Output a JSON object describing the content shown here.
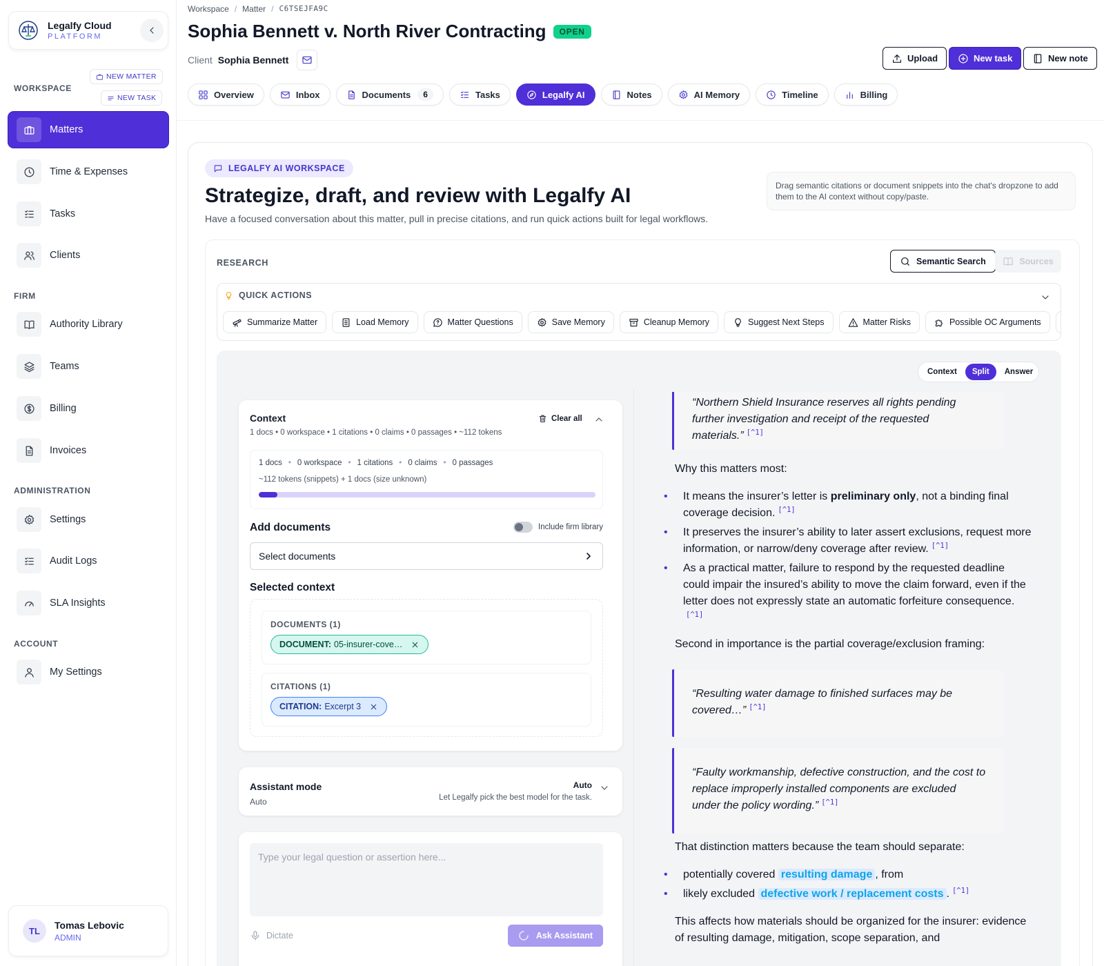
{
  "brand": {
    "name": "Legalfy Cloud",
    "sub": "PLATFORM"
  },
  "sidebar": {
    "sections": {
      "workspace": "WORKSPACE",
      "firm": "FIRM",
      "admin": "ADMINISTRATION",
      "account": "ACCOUNT"
    },
    "new_matter": "NEW MATTER",
    "new_task": "NEW TASK",
    "items": [
      {
        "label": "Matters",
        "icon": "briefcase-icon"
      },
      {
        "label": "Time & Expenses",
        "icon": "clock-icon"
      },
      {
        "label": "Tasks",
        "icon": "list-check-icon"
      },
      {
        "label": "Clients",
        "icon": "users-icon"
      },
      {
        "label": "Authority Library",
        "icon": "book-icon"
      },
      {
        "label": "Teams",
        "icon": "layers-icon"
      },
      {
        "label": "Billing",
        "icon": "dollar-icon"
      },
      {
        "label": "Invoices",
        "icon": "file-icon"
      },
      {
        "label": "Settings",
        "icon": "gear-icon"
      },
      {
        "label": "Audit Logs",
        "icon": "list-check-icon"
      },
      {
        "label": "SLA Insights",
        "icon": "gauge-icon"
      },
      {
        "label": "My Settings",
        "icon": "user-icon"
      }
    ],
    "user": {
      "initials": "TL",
      "name": "Tomas Lebovic",
      "role": "ADMIN"
    }
  },
  "header": {
    "breadcrumb": [
      "Workspace",
      "Matter",
      "C6TSEJFA9C"
    ],
    "title": "Sophia Bennett v. North River Contracting",
    "status": "OPEN",
    "client_label": "Client",
    "client_name": "Sophia Bennett",
    "buttons": {
      "upload": "Upload",
      "new_task": "New task",
      "new_note": "New note"
    },
    "tabs": [
      {
        "label": "Overview"
      },
      {
        "label": "Inbox"
      },
      {
        "label": "Documents",
        "count": "6"
      },
      {
        "label": "Tasks"
      },
      {
        "label": "Legalfy AI"
      },
      {
        "label": "Notes"
      },
      {
        "label": "AI Memory"
      },
      {
        "label": "Timeline"
      },
      {
        "label": "Billing"
      }
    ]
  },
  "workspace": {
    "pill": "LEGALFY AI WORKSPACE",
    "title": "Strategize, draft, and review with Legalfy AI",
    "subtitle": "Have a focused conversation about this matter, pull in precise citations, and run quick actions built for legal workflows.",
    "tip": "Drag semantic citations or document snippets into the chat's dropzone to add them to the AI context without copy/paste."
  },
  "research": {
    "label": "RESEARCH",
    "semantic_search": "Semantic Search",
    "sources": "Sources",
    "quick_actions_label": "QUICK ACTIONS",
    "quick_actions": [
      "Summarize Matter",
      "Load Memory",
      "Matter Questions",
      "Save Memory",
      "Cleanup Memory",
      "Suggest Next Steps",
      "Matter Risks",
      "Possible OC Arguments"
    ],
    "view_modes": [
      "Context",
      "Split",
      "Answer"
    ],
    "active_view": "Split"
  },
  "context": {
    "title": "Context",
    "meta": "1 docs • 0 workspace • 1 citations • 0 claims • 0 passages • ~112 tokens",
    "clear_all": "Clear all",
    "stats": [
      "1 docs",
      "0 workspace",
      "1 citations",
      "0 claims",
      "0 passages"
    ],
    "tokens": "~112 tokens (snippets) + 1 docs (size unknown)",
    "progress_fraction": 0.055,
    "add_documents": "Add documents",
    "include_firm_library": "Include firm library",
    "select_documents": "Select documents",
    "selected_context": "Selected context",
    "documents_group": "DOCUMENTS (1)",
    "document_chip_type": "DOCUMENT:",
    "document_chip_value": "05-insurer-cove…",
    "citations_group": "CITATIONS (1)",
    "citation_chip_type": "CITATION:",
    "citation_chip_value": "Excerpt 3"
  },
  "assistant_mode": {
    "title": "Assistant mode",
    "value": "Auto",
    "selected": "Auto",
    "description": "Let Legalfy pick the best model for the task."
  },
  "composer": {
    "placeholder": "Type your legal question or assertion here...",
    "dictate": "Dictate",
    "ask": "Ask Assistant"
  },
  "answer": {
    "ref": "[^1]",
    "quote1": "“Northern Shield Insurance reserves all rights pending further investigation and receipt of the requested materials.”",
    "why": "Why this matters most:",
    "b1_pre": "It means the insurer’s letter is ",
    "b1_bold": "preliminary only",
    "b1_post": ", not a binding final coverage decision.",
    "b2": "It preserves the insurer’s ability to later assert exclusions, request more information, or narrow/deny coverage after review.",
    "b3": "As a practical matter, failure to respond by the requested deadline could impair the insured’s ability to move the claim forward, even if the letter does not expressly state an automatic forfeiture consequence.",
    "second": "Second in importance is the partial coverage/exclusion framing:",
    "quote2": "“Resulting water damage to finished surfaces may be covered…”",
    "quote3": "“Faulty workmanship, defective construction, and the cost to replace improperly installed components are excluded under the policy wording.”",
    "distinction": "That distinction matters because the team should separate:",
    "c1_pre": "potentially covered ",
    "c1_hl": "resulting damage",
    "c1_post": ", from",
    "c2_pre": "likely excluded ",
    "c2_hl": "defective work / replacement costs",
    "c2_post": ".",
    "closing": "This affects how materials should be organized for the insurer: evidence of resulting damage, mitigation, scope separation, and"
  }
}
